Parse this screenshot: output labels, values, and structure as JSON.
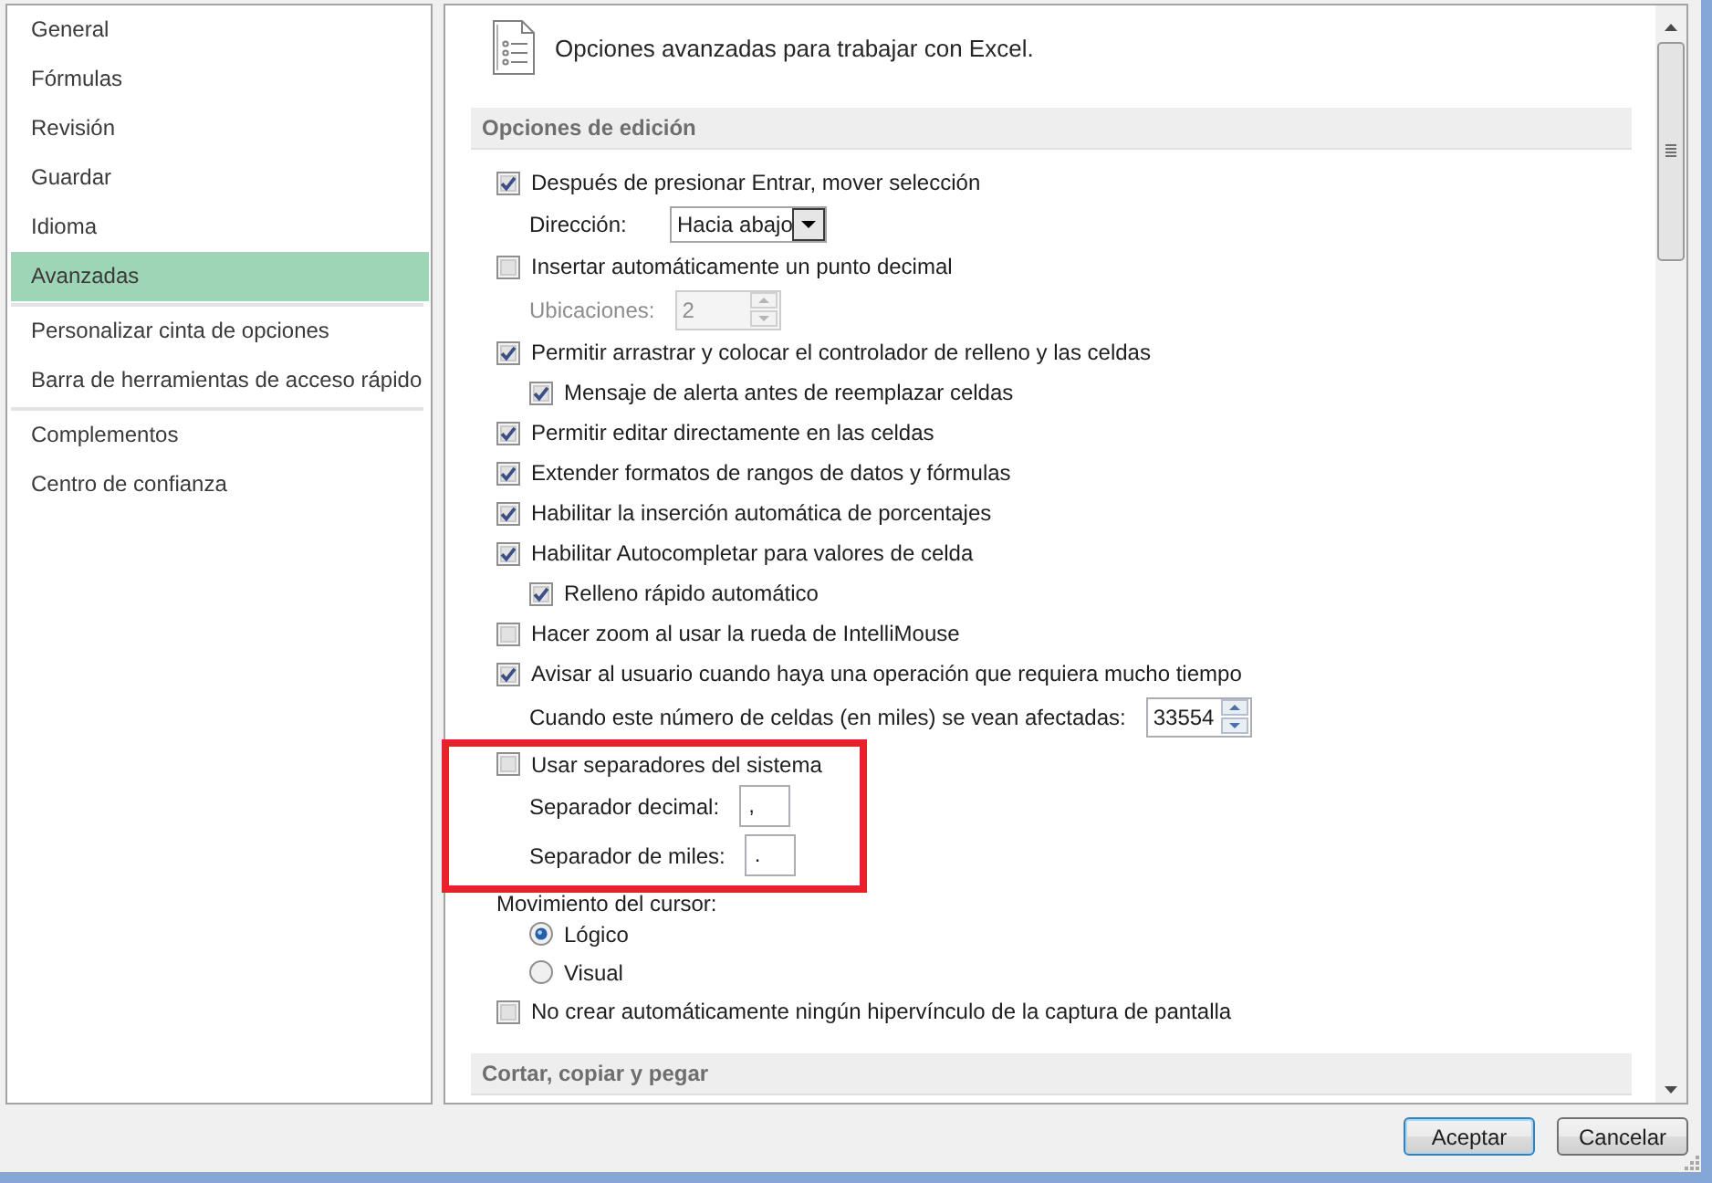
{
  "sidebar": {
    "groups": [
      {
        "items": [
          {
            "label": "General",
            "selected": false
          },
          {
            "label": "Fórmulas",
            "selected": false
          },
          {
            "label": "Revisión",
            "selected": false
          },
          {
            "label": "Guardar",
            "selected": false
          },
          {
            "label": "Idioma",
            "selected": false
          },
          {
            "label": "Avanzadas",
            "selected": true
          }
        ]
      },
      {
        "items": [
          {
            "label": "Personalizar cinta de opciones",
            "selected": false
          },
          {
            "label": "Barra de herramientas de acceso rápido",
            "selected": false
          }
        ]
      },
      {
        "items": [
          {
            "label": "Complementos",
            "selected": false
          },
          {
            "label": "Centro de confianza",
            "selected": false
          }
        ]
      }
    ]
  },
  "header": {
    "title": "Opciones avanzadas para trabajar con Excel."
  },
  "sections": [
    {
      "title": "Opciones de edición",
      "options": [
        {
          "kind": "checkbox",
          "label": "Después de presionar Entrar, mover selección",
          "checked": true,
          "children": [
            {
              "kind": "dropdown",
              "label": "Dirección:",
              "value": "Hacia abajo"
            }
          ]
        },
        {
          "kind": "checkbox",
          "label": "Insertar automáticamente un punto decimal",
          "checked": false,
          "children": [
            {
              "kind": "spinner",
              "label": "Ubicaciones:",
              "value": "2",
              "disabled": true
            }
          ]
        },
        {
          "kind": "checkbox",
          "label": "Permitir arrastrar y colocar el controlador de relleno y las celdas",
          "checked": true,
          "children": [
            {
              "kind": "checkbox",
              "label": "Mensaje de alerta antes de reemplazar celdas",
              "checked": true
            }
          ]
        },
        {
          "kind": "checkbox",
          "label": "Permitir editar directamente en las celdas",
          "checked": true
        },
        {
          "kind": "checkbox",
          "label": "Extender formatos de rangos de datos y fórmulas",
          "checked": true
        },
        {
          "kind": "checkbox",
          "label": "Habilitar la inserción automática de porcentajes",
          "checked": true
        },
        {
          "kind": "checkbox",
          "label": "Habilitar Autocompletar para valores de celda",
          "checked": true,
          "children": [
            {
              "kind": "checkbox",
              "label": "Relleno rápido automático",
              "checked": true
            }
          ]
        },
        {
          "kind": "checkbox",
          "label": "Hacer zoom al usar la rueda de IntelliMouse",
          "checked": false
        },
        {
          "kind": "checkbox",
          "label": "Avisar al usuario cuando haya una operación que requiera mucho tiempo",
          "checked": true,
          "children": [
            {
              "kind": "spinner",
              "label": "Cuando este número de celdas (en miles) se vean afectadas:",
              "value": "33554",
              "disabled": false
            }
          ]
        },
        {
          "kind": "checkbox",
          "label": "Usar separadores del sistema",
          "checked": false,
          "highlighted": true,
          "children": [
            {
              "kind": "text_field",
              "label": "Separador decimal:",
              "value": ","
            },
            {
              "kind": "text_field",
              "label": "Separador de miles:",
              "value": "."
            }
          ]
        },
        {
          "kind": "heading",
          "label": "Movimiento del cursor:",
          "children": [
            {
              "kind": "radio",
              "label": "Lógico",
              "selected": true
            },
            {
              "kind": "radio",
              "label": "Visual",
              "selected": false
            }
          ]
        },
        {
          "kind": "checkbox",
          "label": "No crear automáticamente ningún hipervínculo de la captura de pantalla",
          "checked": false
        }
      ]
    },
    {
      "title": "Cortar, copiar y pegar"
    }
  ],
  "buttons": [
    {
      "label": "Aceptar",
      "default": true
    },
    {
      "label": "Cancelar",
      "default": false
    }
  ]
}
